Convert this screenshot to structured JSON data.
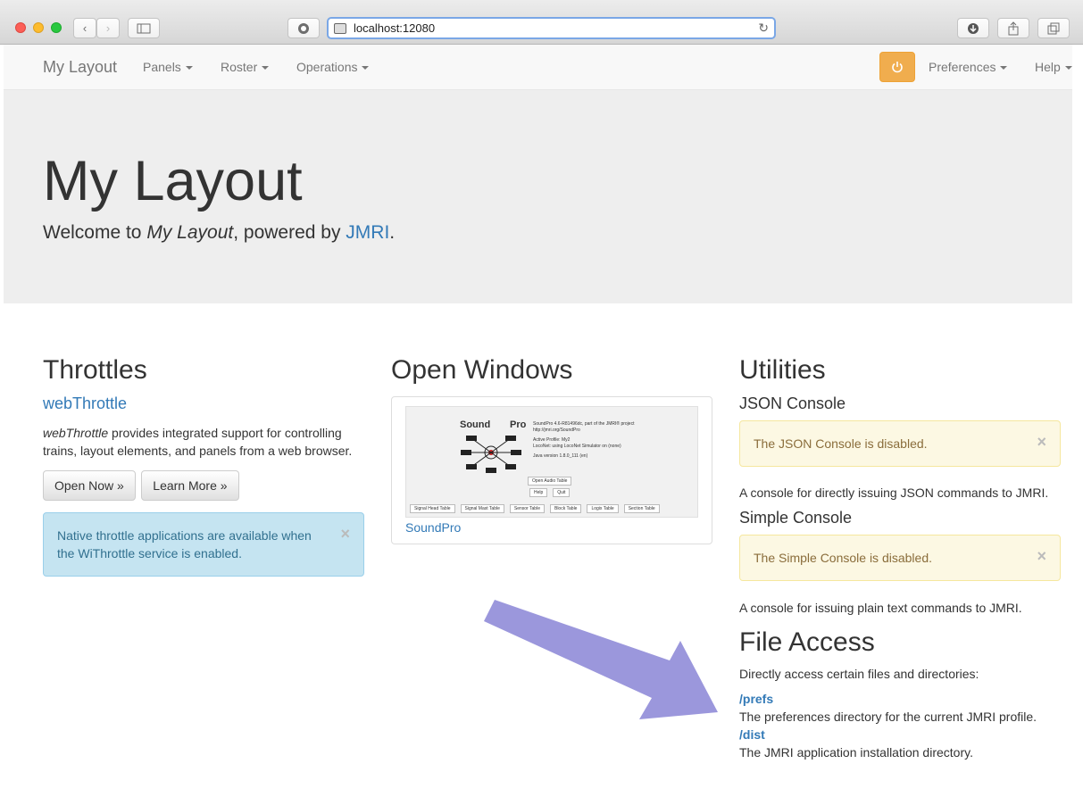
{
  "browser": {
    "url": "localhost:12080"
  },
  "navbar": {
    "brand": "My Layout",
    "menus": [
      "Panels",
      "Roster",
      "Operations"
    ],
    "right_menus": [
      "Preferences",
      "Help"
    ],
    "power_icon": "power-icon"
  },
  "jumbotron": {
    "title": "My Layout",
    "welcome_prefix": "Welcome to ",
    "welcome_name": "My Layout",
    "welcome_middle": ", powered by ",
    "welcome_link": "JMRI",
    "welcome_suffix": "."
  },
  "throttles": {
    "heading": "Throttles",
    "link": "webThrottle",
    "desc_em": "webThrottle",
    "desc_rest": " provides integrated support for controlling trains, layout elements, and panels from a web browser.",
    "open_button": "Open Now »",
    "learn_button": "Learn More »",
    "alert": "Native throttle applications are available when the WiThrottle service is enabled.",
    "alert_close": "×"
  },
  "open_windows": {
    "heading": "Open Windows",
    "caption": "SoundPro",
    "screenshot": {
      "title_left": "Sound",
      "title_right": "Pro",
      "lines": [
        "SoundPro 4.6-R81496dc, part of the JMRI® project",
        "http://jmri.org/SoundPro",
        "Active Profile: My2",
        "LocoNet: using LocoNet Simulator on (none)",
        "Java version 1.8.0_111 (en)"
      ],
      "center_buttons": [
        "Open Audio Table",
        "Help",
        "Quit"
      ],
      "bottom_buttons": [
        "Signal Head Table",
        "Signal Mast Table",
        "Sensor Table",
        "Block Table",
        "Logix Table",
        "Section Table"
      ]
    }
  },
  "utilities": {
    "heading": "Utilities",
    "json_heading": "JSON Console",
    "json_alert": "The JSON Console is disabled.",
    "json_desc": "A console for directly issuing JSON commands to JMRI.",
    "simple_heading": "Simple Console",
    "simple_alert": "The Simple Console is disabled.",
    "simple_desc": "A console for issuing plain text commands to JMRI.",
    "close": "×"
  },
  "file_access": {
    "heading": "File Access",
    "intro": "Directly access certain files and directories:",
    "items": [
      {
        "link": "/prefs",
        "desc": "The preferences directory for the current JMRI profile."
      },
      {
        "link": "/dist",
        "desc": "The JMRI application installation directory."
      }
    ]
  },
  "colors": {
    "link": "#337ab7",
    "warning_button": "#f0ad4e",
    "annotation_arrow": "#9b97dc"
  }
}
